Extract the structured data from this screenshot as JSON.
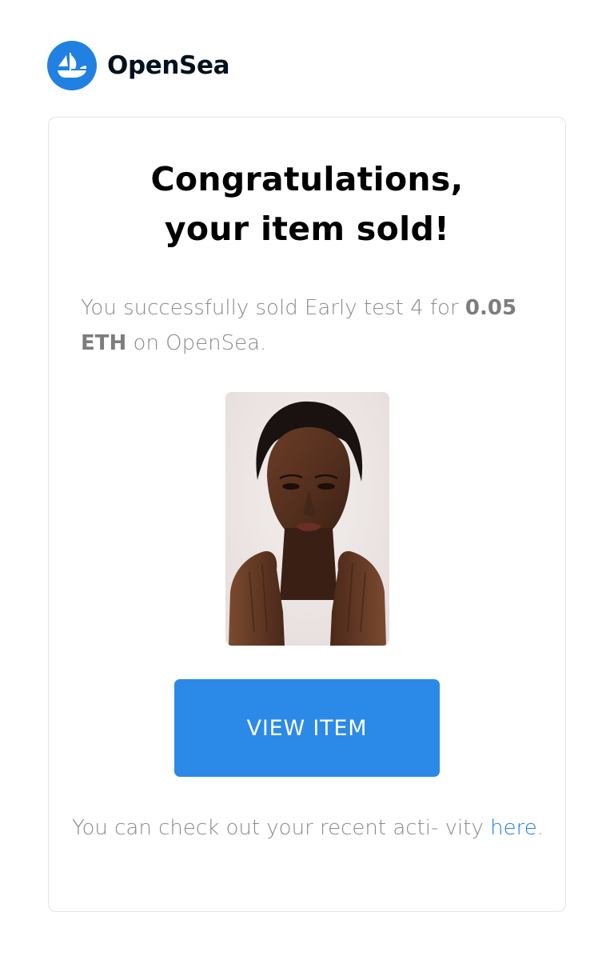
{
  "header": {
    "brand_name": "OpenSea",
    "logo_icon": "opensea-ship-icon",
    "brand_color": "#2081e2"
  },
  "card": {
    "headline_line1": "Congratulations,",
    "headline_line2": "your item sold!",
    "message": {
      "prefix": "You successfully sold Early test 4 for ",
      "price": "0.05 ETH",
      "suffix": " on OpenSea."
    },
    "item_image": {
      "icon": "nft-portrait-image",
      "alt": "Early test 4"
    },
    "view_button_label": "VIEW ITEM",
    "footer": {
      "text": "You can check out your recent acti- vity ",
      "link_label": "here",
      "end": "."
    }
  },
  "colors": {
    "accent": "#2081e2",
    "button": "#2b8ae8",
    "muted_text": "#8a8a8a",
    "card_border": "#e2e4e7"
  }
}
